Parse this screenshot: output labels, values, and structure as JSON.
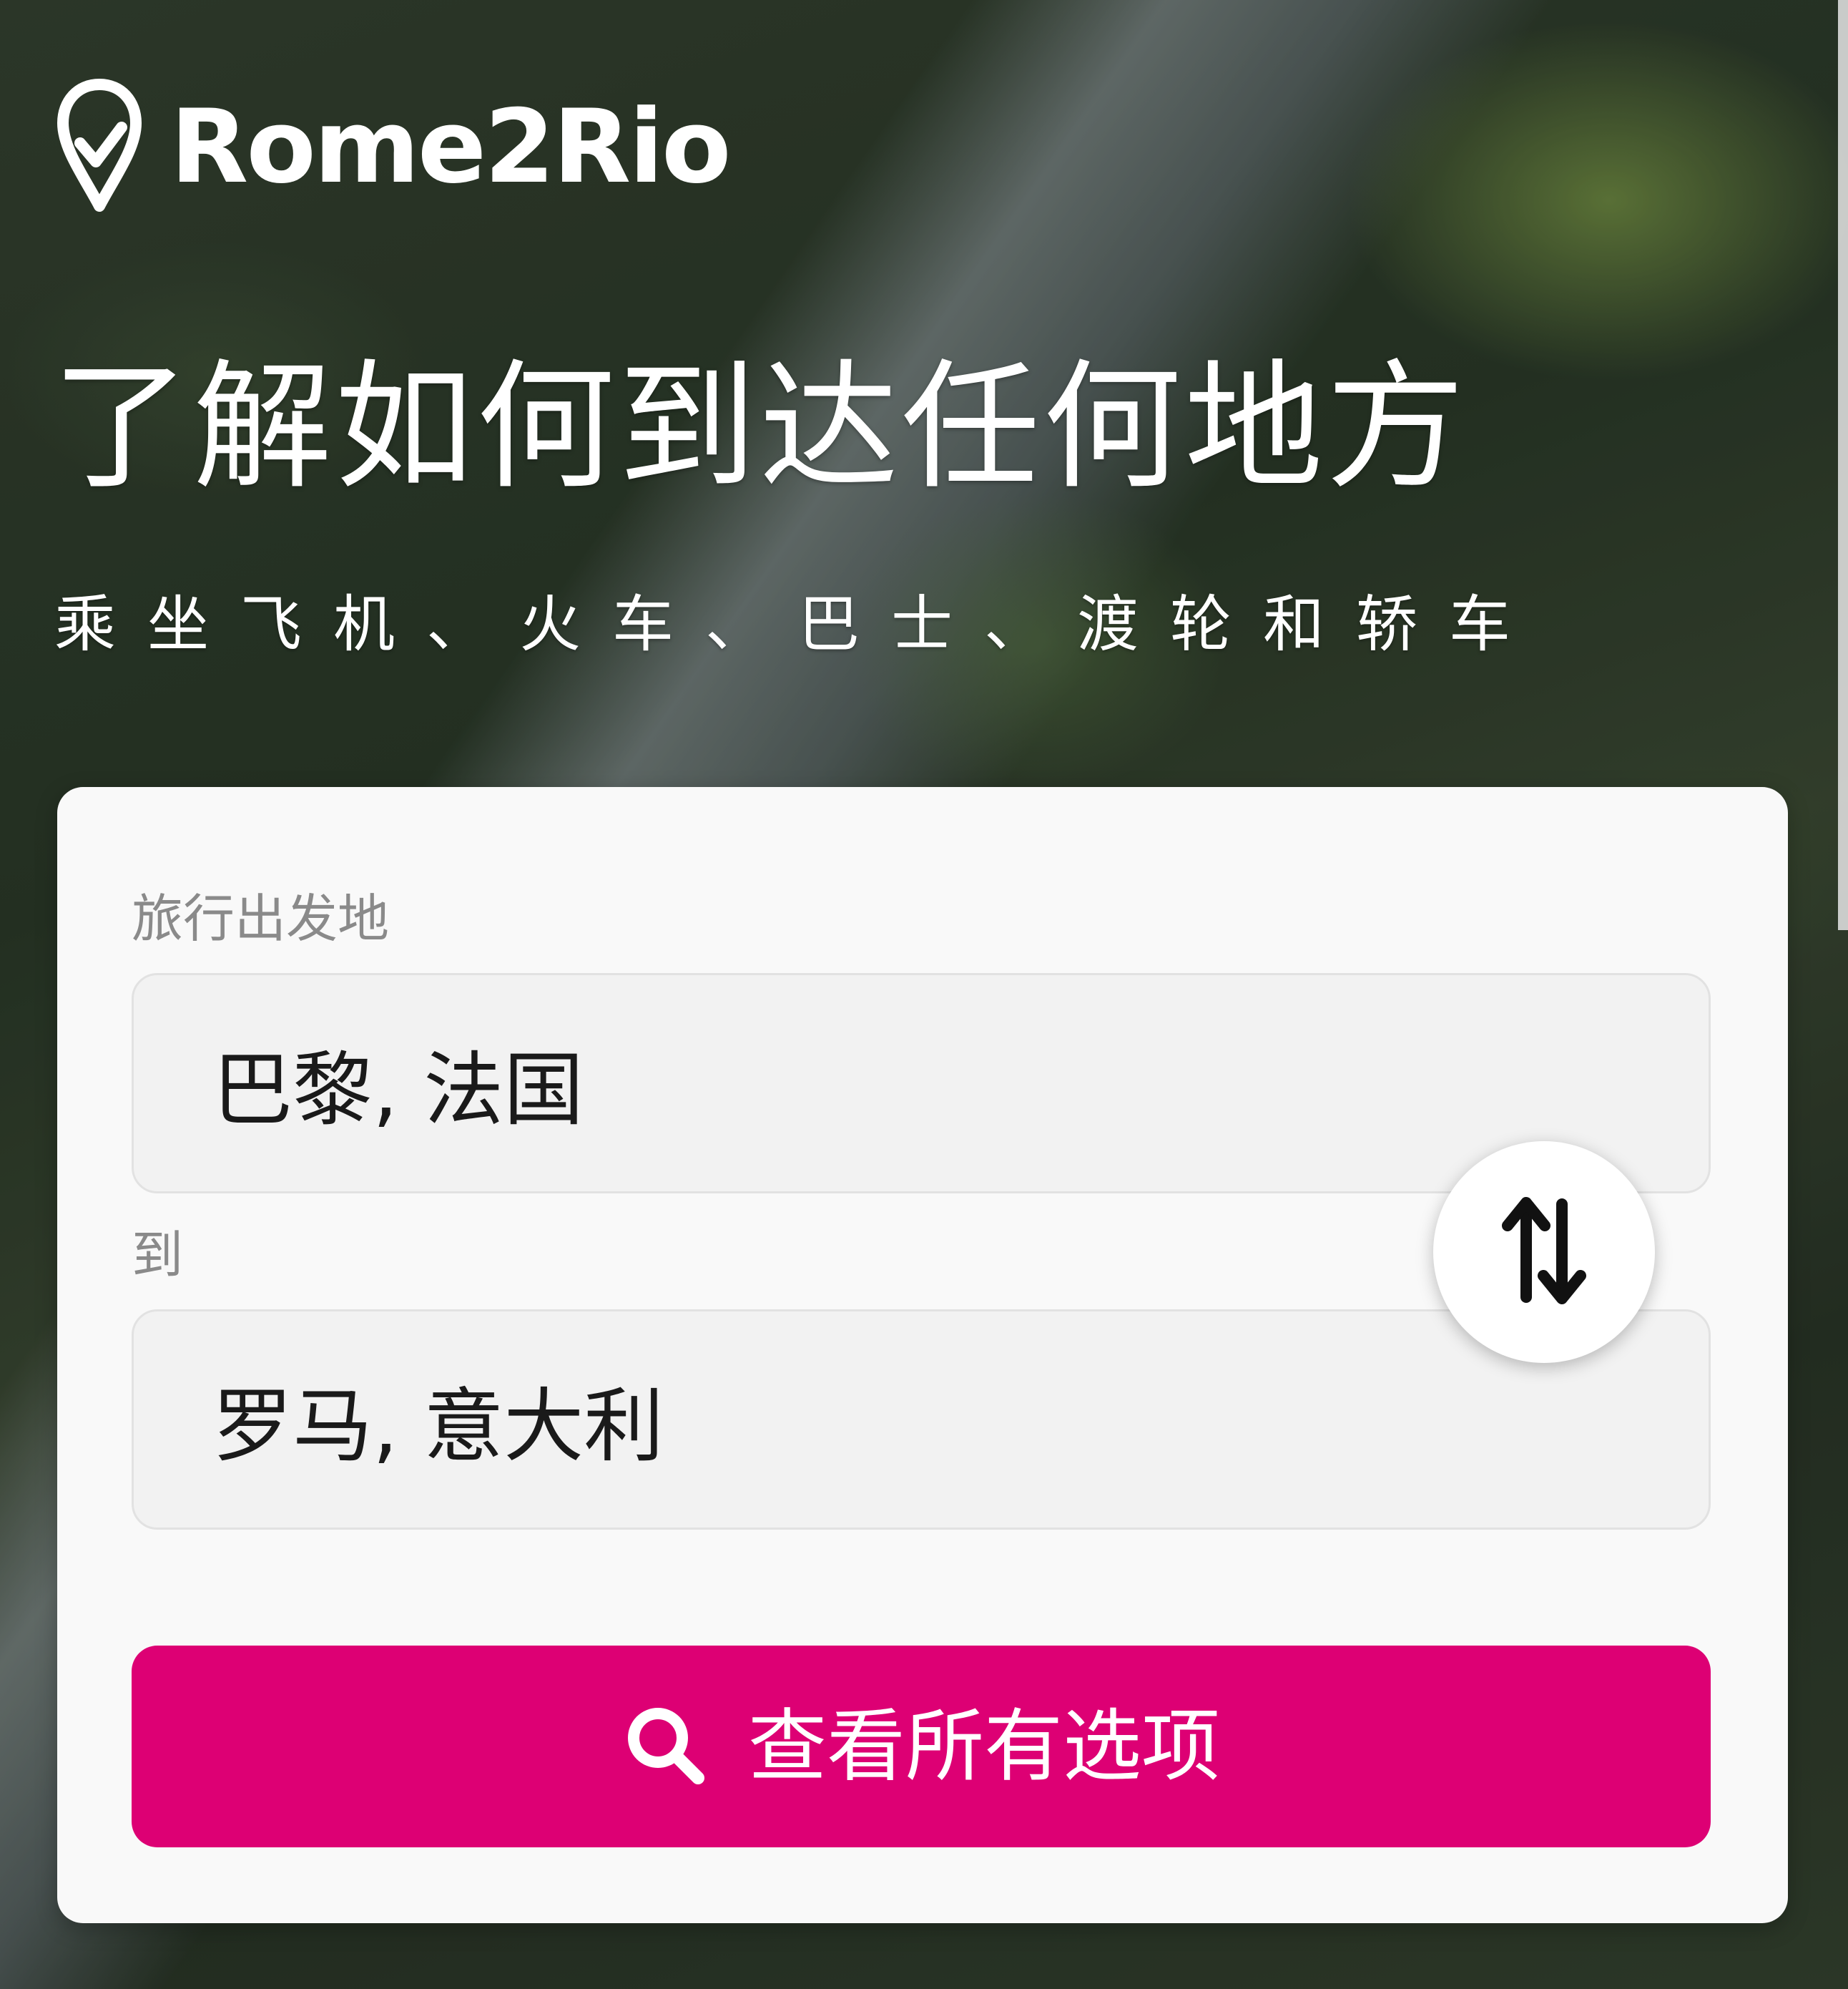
{
  "brand": {
    "name": "Rome2Rio",
    "logo_icon": "map-pin-check-icon"
  },
  "hero": {
    "headline": "了解如何到达任何地方",
    "subline": "乘坐飞机、火车、巴士、渡轮和轿车"
  },
  "search_form": {
    "origin": {
      "label": "旅行出发地",
      "value": "巴黎, 法国"
    },
    "destination": {
      "label": "到",
      "value": "罗马, 意大利"
    },
    "swap_icon": "swap-vertical-arrows-icon",
    "submit": {
      "label": "查看所有选项",
      "icon": "search-icon"
    }
  },
  "colors": {
    "accent": "#dd0074",
    "card_background": "#f9f9f9",
    "field_background": "#f2f2f2",
    "label_text": "#8a8a8a",
    "value_text": "#1a1a1a"
  }
}
